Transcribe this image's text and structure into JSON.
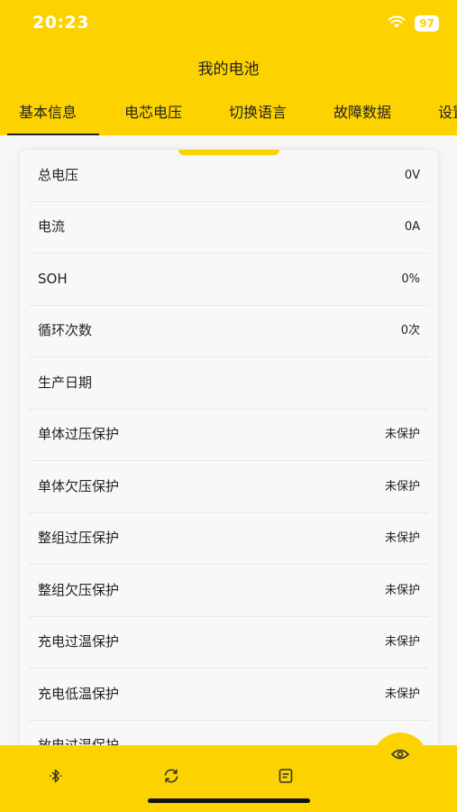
{
  "status_bar": {
    "time": "20:23",
    "battery": "97"
  },
  "header": {
    "title": "我的电池"
  },
  "tabs": [
    {
      "label": "基本信息",
      "active": true
    },
    {
      "label": "电芯电压",
      "active": false
    },
    {
      "label": "切换语言",
      "active": false
    },
    {
      "label": "故障数据",
      "active": false
    },
    {
      "label": "设置",
      "active": false
    }
  ],
  "info_rows": [
    {
      "label": "总电压",
      "value": "0V"
    },
    {
      "label": "电流",
      "value": "0A"
    },
    {
      "label": "SOH",
      "value": "0%"
    },
    {
      "label": "循环次数",
      "value": "0次"
    },
    {
      "label": "生产日期",
      "value": ""
    },
    {
      "label": "单体过压保护",
      "value": "未保护"
    },
    {
      "label": "单体欠压保护",
      "value": "未保护"
    },
    {
      "label": "整组过压保护",
      "value": "未保护"
    },
    {
      "label": "整组欠压保护",
      "value": "未保护"
    },
    {
      "label": "充电过温保护",
      "value": "未保护"
    },
    {
      "label": "充电低温保护",
      "value": "未保护"
    },
    {
      "label": "放电过温保护",
      "value": ""
    }
  ],
  "bottom_nav": [
    "bluetooth-icon",
    "refresh-icon",
    "document-icon",
    "eye-icon"
  ],
  "colors": {
    "accent": "#fcd200",
    "text": "#222222",
    "background": "#f6f6f6"
  }
}
